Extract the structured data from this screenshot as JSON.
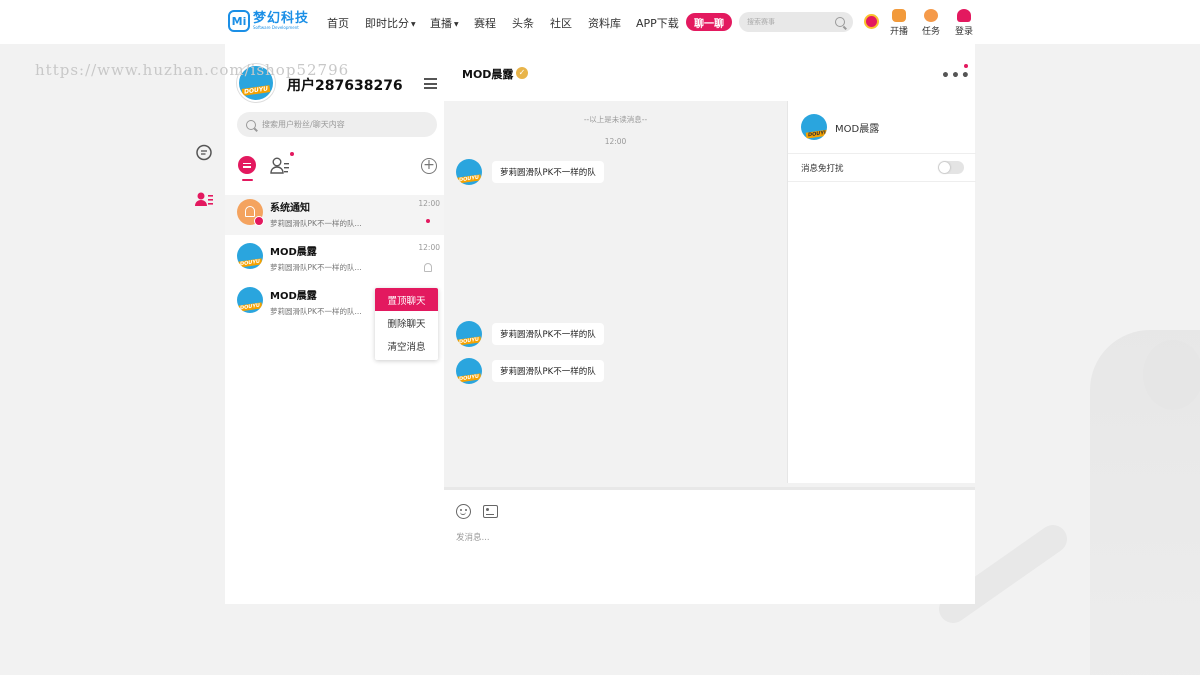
{
  "nav": {
    "logo_badge": "Mi",
    "logo_name": "梦幻科技",
    "logo_sub": "Software Development",
    "links": [
      "首页",
      "即时比分",
      "直播",
      "赛程",
      "头条",
      "社区",
      "资料库",
      "APP下载"
    ],
    "chat_button": "聊一聊",
    "search_placeholder": "搜索赛事",
    "tools": [
      {
        "label": "开播",
        "icon": "broadcast-icon",
        "color": "#f29a3b"
      },
      {
        "label": "任务",
        "icon": "task-icon",
        "color": "#f59a4a"
      },
      {
        "label": "登录",
        "icon": "user-icon",
        "color": "#e3195f"
      }
    ]
  },
  "watermark": "https://www.huzhan.com/ishop52796",
  "left_panel": {
    "avatar_text": "DOUYU",
    "username": "用户287638276",
    "search_placeholder": "搜索用户粉丝/聊天内容",
    "conversations": [
      {
        "name": "系统通知",
        "preview": "萝莉圆滑队PK不一样的队...",
        "time": "12:00",
        "type": "system"
      },
      {
        "name": "MOD晨露",
        "preview": "萝莉圆滑队PK不一样的队...",
        "time": "12:00",
        "type": "user"
      },
      {
        "name": "MOD晨露",
        "preview": "萝莉圆滑队PK不一样的队...",
        "time": "",
        "type": "user"
      }
    ],
    "context_menu": [
      "置顶聊天",
      "删除聊天",
      "清空消息"
    ]
  },
  "chat": {
    "title": "MOD晨露",
    "unread_divider": "--以上是未读消息--",
    "timestamp": "12:00",
    "messages": [
      "萝莉圆滑队PK不一样的队",
      "萝莉圆滑队PK不一样的队",
      "萝莉圆滑队PK不一样的队"
    ],
    "input_placeholder": "发消息..."
  },
  "info_panel": {
    "name": "MOD晨露",
    "do_not_disturb_label": "消息免打扰",
    "do_not_disturb_on": false
  },
  "colors": {
    "accent": "#e3195f",
    "brand": "#1b8fe6",
    "verified": "#e8b44a"
  }
}
